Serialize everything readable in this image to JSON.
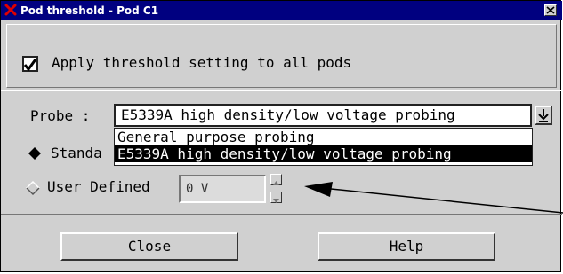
{
  "window": {
    "title": "Pod threshold - Pod C1",
    "close_glyph": "✕"
  },
  "apply": {
    "label": "Apply threshold setting to all pods",
    "checked": true
  },
  "probe": {
    "label": "Probe :",
    "value": "E5339A high density/low voltage probing",
    "options": [
      "General purpose probing",
      "E5339A high density/low voltage probing"
    ],
    "selected_index": 1
  },
  "threshold": {
    "standard_label": "Standa",
    "user_label": "User Defined",
    "user_value": "0 V"
  },
  "buttons": {
    "close": "Close",
    "help": "Help"
  },
  "colors": {
    "title_bar": "#000080",
    "dialog_bg": "#d0d0d0",
    "selection": "#000000"
  },
  "icons": {
    "window_icon": "red-x-icon",
    "close": "close-icon",
    "dropdown": "dropdown-arrow-icon",
    "spin_up": "spin-up-icon",
    "spin_down": "spin-down-icon"
  }
}
